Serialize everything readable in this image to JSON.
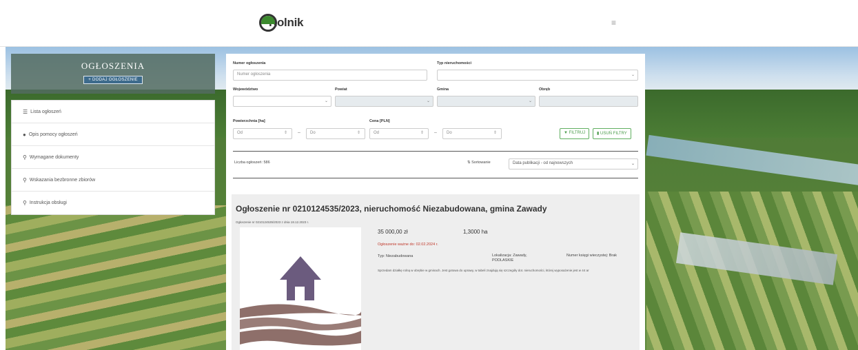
{
  "header": {
    "logo_text": "Rolnik",
    "menu_icon": "menu-icon"
  },
  "sidebar": {
    "title": "OGŁOSZENIA",
    "add_button": "DODAJ OGŁOSZENIE",
    "items": [
      {
        "icon": "list-icon",
        "label": "Lista ogłoszeń"
      },
      {
        "icon": "info-icon",
        "label": "Opis pomocy ogłoszeń"
      },
      {
        "icon": "pin-icon",
        "label": "Wymagane dokumenty"
      },
      {
        "icon": "pin-icon",
        "label": "Wskazania bezbronne zbiorów"
      },
      {
        "icon": "pin-icon",
        "label": "Instrukcja obsługi"
      }
    ]
  },
  "filters": {
    "numer_label": "Numer ogłoszenia",
    "numer_placeholder": "Numer ogłoszenia",
    "typ_label": "Typ nieruchomości",
    "typ_value": "",
    "woj_label": "Województwo",
    "powiat_label": "Powiat",
    "gmina_label": "Gmina",
    "obreb_label": "Obręb",
    "powierzchnia_label": "Powierzchnia [ha]",
    "powierzchnia_od": "Od",
    "powierzchnia_do": "Do",
    "cena_label": "Cena [PLN]",
    "cena_od": "Od",
    "cena_do": "Do",
    "filter_button": "FILTRUJ",
    "clear_button": "USUŃ FILTRY"
  },
  "list": {
    "count_text": "Liczba ogłoszeń: 586",
    "sort_label": "Sortowanie",
    "sort_value": "Data publikacji - od najnowszych"
  },
  "listing": {
    "title": "Ogłoszenie nr 0210124535/2023, nieruchomość Niezabudowana, gmina Zawady",
    "sub": "Ogłoszenie nr 0210124535/2023 z dnia 18.12.2023 r.",
    "price": "35 000,00 zł",
    "area": "1,3000 ha",
    "valid_until": "Ogłoszenie ważne do: 02.02.2024 r.",
    "type": "Typ: Niezabudowana",
    "location": "Lokalizacja: Zawady, PODLASKIE",
    "kw": "Numer księgi wieczystej: Brak",
    "description": "Sprzedam działkę rolną w obrębie w gminach. Jest gotowa do uprawy, w tabeli znajdują się szczegóły dot. nieruchomości, której wyposażenie jest w 44 ar"
  },
  "colors": {
    "accent_green": "#4a9b4a",
    "sidebar_header": "#526b60",
    "valid_red": "#c0392b",
    "house_purple": "#6b5b7e",
    "fields_brown": "#8e6f6a"
  }
}
